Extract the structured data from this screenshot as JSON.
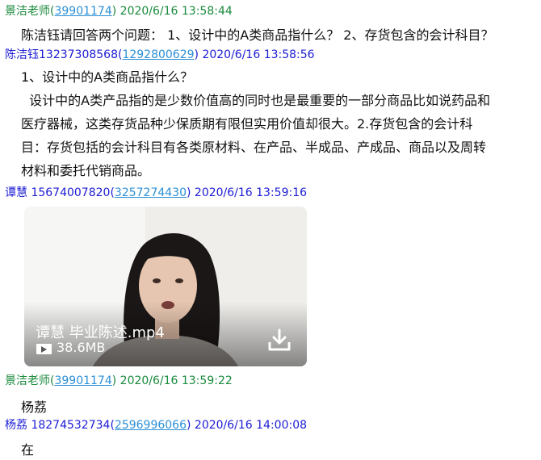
{
  "messages": [
    {
      "sender": "景洁老师",
      "qq": "39901174",
      "time": "2020/6/16 13:58:44",
      "text": "陈洁钰请回答两个问题： 1、设计中的A类商品指什么？ 2、存货包含的会计科目？"
    },
    {
      "sender": "陈洁钰13237308568",
      "qq": "1292800629",
      "time": "2020/6/16 13:58:56",
      "lines": [
        "1、设计中的A类商品指什么？",
        "  设计中的A类产品指的是少数价值高的同时也是最重要的一部分商品比如说药品和",
        "医疗器械，这类存货品种少保质期有限但实用价值却很大。2.存货包含的会计科",
        "目：存货包括的会计科目有各类原材料、在产品、半成品、产成品、商品以及周转",
        "材料和委托代销商品。"
      ]
    },
    {
      "sender": "谭慧 15674007820",
      "qq": "3257274430",
      "time": "2020/6/16 13:59:16",
      "video": {
        "filename": "谭慧 毕业陈述.mp4",
        "size": "38.6MB"
      }
    },
    {
      "sender": "景洁老师",
      "qq": "39901174",
      "time": "2020/6/16 13:59:22",
      "text": "杨荔"
    },
    {
      "sender": "杨荔 18274532734",
      "qq": "2596996066",
      "time": "2020/6/16 14:00:08",
      "text": "在"
    }
  ]
}
